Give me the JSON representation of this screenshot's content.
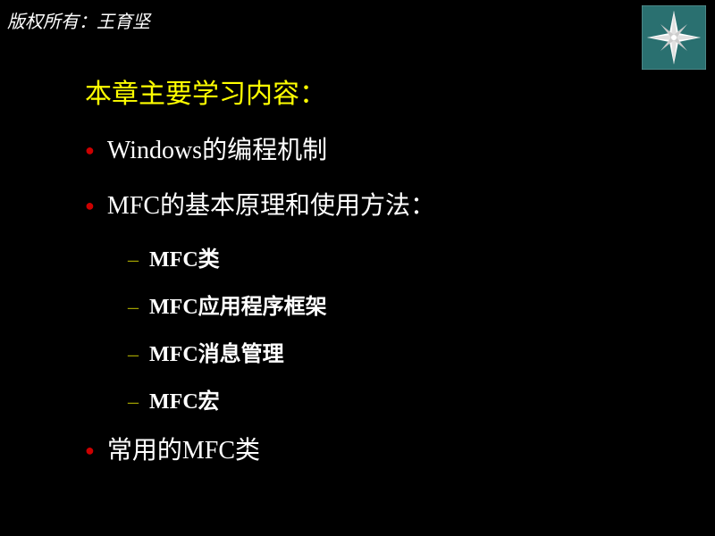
{
  "copyright": "版权所有：王育坚",
  "heading": "本章主要学习内容：",
  "bullets": [
    "Windows的编程机制",
    "MFC的基本原理和使用方法：",
    "常用的MFC类"
  ],
  "subBullets": [
    "MFC类",
    "MFC应用程序框架",
    "MFC消息管理",
    "MFC宏"
  ]
}
